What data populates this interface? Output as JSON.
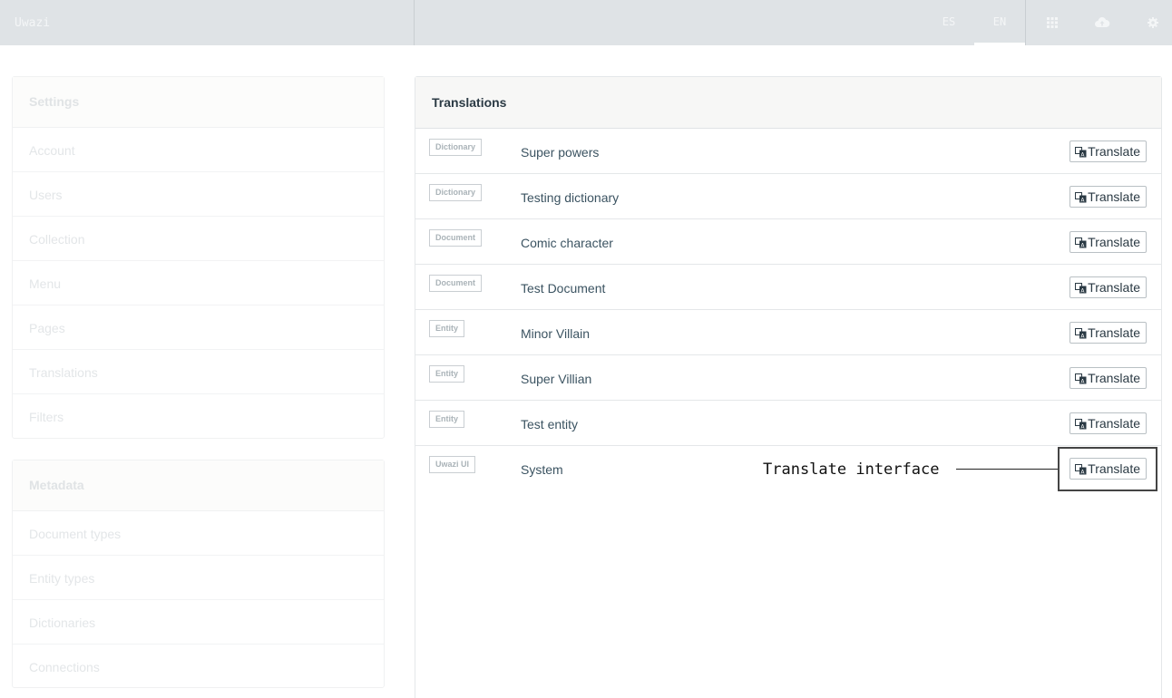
{
  "topbar": {
    "brand": "Uwazi",
    "languages": [
      {
        "code": "ES",
        "active": false
      },
      {
        "code": "EN",
        "active": true
      }
    ],
    "icons": [
      "grid-icon",
      "cloud-upload-icon",
      "gear-icon"
    ]
  },
  "sidebar": {
    "settings": {
      "title": "Settings",
      "items": [
        "Account",
        "Users",
        "Collection",
        "Menu",
        "Pages",
        "Translations",
        "Filters"
      ]
    },
    "metadata": {
      "title": "Metadata",
      "items": [
        "Document types",
        "Entity types",
        "Dictionaries",
        "Connections"
      ]
    }
  },
  "main": {
    "title": "Translations",
    "button_label": "Translate",
    "rows": [
      {
        "type": "Dictionary",
        "title": "Super powers"
      },
      {
        "type": "Dictionary",
        "title": "Testing dictionary"
      },
      {
        "type": "Document",
        "title": "Comic character"
      },
      {
        "type": "Document",
        "title": "Test Document"
      },
      {
        "type": "Entity",
        "title": "Minor Villain"
      },
      {
        "type": "Entity",
        "title": "Super Villian"
      },
      {
        "type": "Entity",
        "title": "Test entity"
      },
      {
        "type": "Uwazi UI",
        "title": "System"
      }
    ]
  },
  "annotation": {
    "label": "Translate interface"
  },
  "colors": {
    "topbar_bg": "#dfe3e6",
    "text_primary": "#2b3a44",
    "link_text": "#3b5361",
    "sidebar_text_faded": "#e3e6e8"
  }
}
